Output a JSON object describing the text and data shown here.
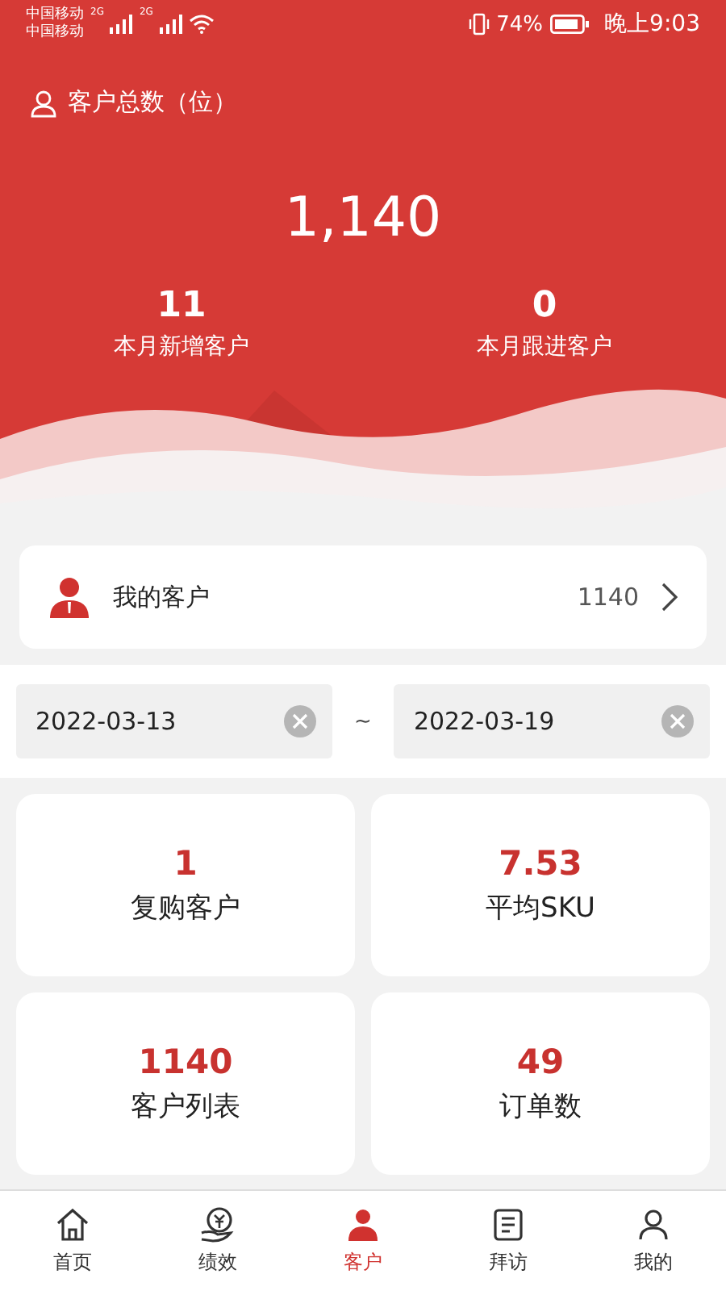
{
  "status_bar": {
    "carriers": [
      "中国移动",
      "中国移动"
    ],
    "network_labels": [
      "2G",
      "2G"
    ],
    "battery": "74%",
    "time": "晚上9:03"
  },
  "summary": {
    "total_label": "客户总数（位）",
    "total": "1,140",
    "stats": [
      {
        "value": "11",
        "label": "本月新增客户"
      },
      {
        "value": "0",
        "label": "本月跟进客户"
      }
    ]
  },
  "my_customers": {
    "label": "我的客户",
    "count": "1140"
  },
  "date_range": {
    "start": "2022-03-13",
    "separator": "~",
    "end": "2022-03-19"
  },
  "metrics": [
    {
      "value": "1",
      "label": "复购客户"
    },
    {
      "value": "7.53",
      "label": "平均SKU"
    },
    {
      "value": "1140",
      "label": "客户列表"
    },
    {
      "value": "49",
      "label": "订单数"
    }
  ],
  "tab_bar": [
    {
      "label": "首页",
      "kind": "home",
      "selected": false
    },
    {
      "label": "绩效",
      "kind": "money",
      "selected": false
    },
    {
      "label": "客户",
      "kind": "customer",
      "selected": true
    },
    {
      "label": "拜访",
      "kind": "visit",
      "selected": false
    },
    {
      "label": "我的",
      "kind": "me",
      "selected": false
    }
  ]
}
